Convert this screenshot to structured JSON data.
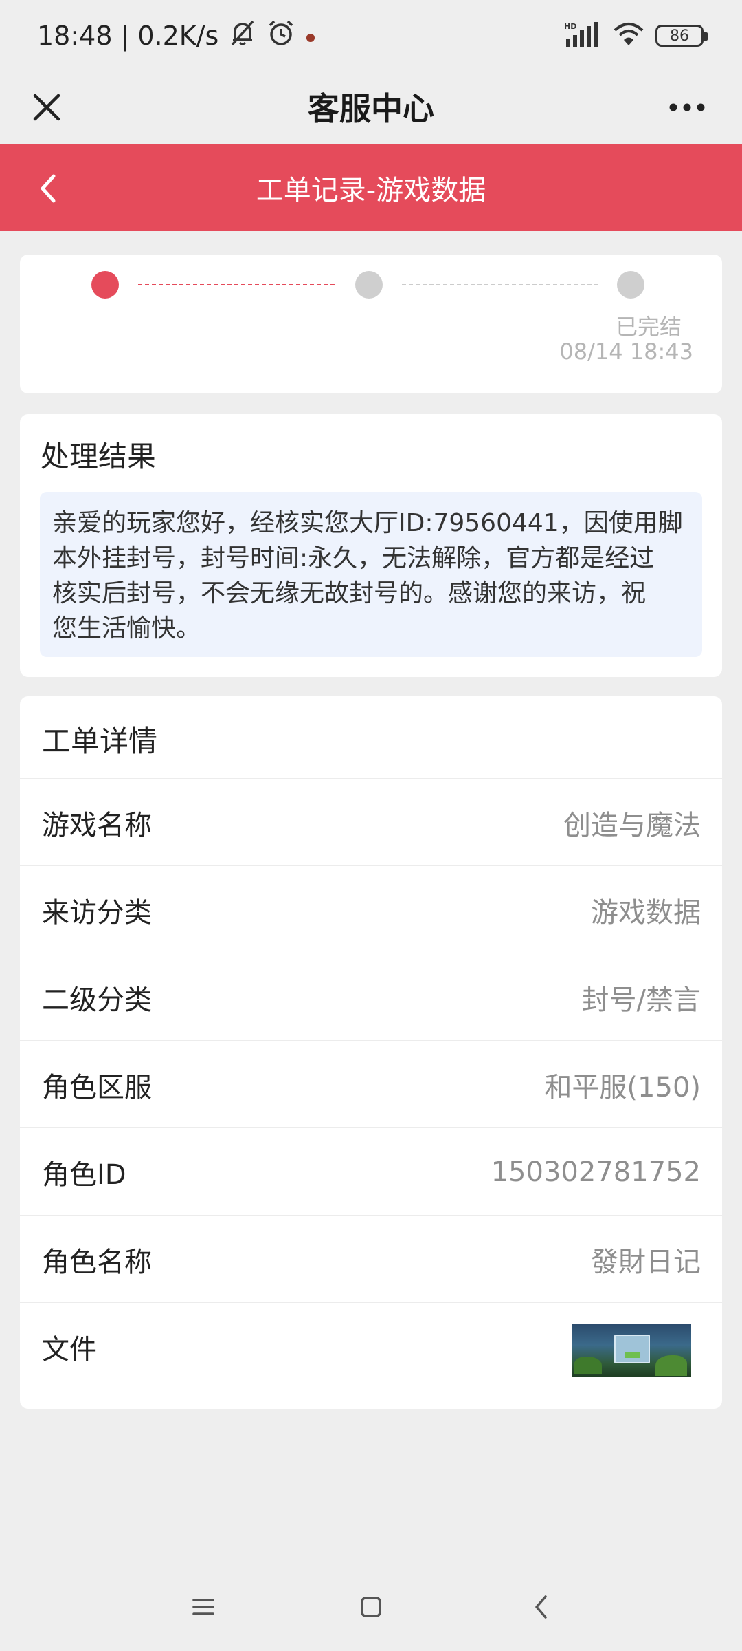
{
  "status_bar": {
    "time": "18:48",
    "separator": "|",
    "net_speed": "0.2K/s",
    "battery": "86",
    "signal_tag": "HD"
  },
  "header": {
    "title": "客服中心"
  },
  "subheader": {
    "title": "工单记录-游戏数据"
  },
  "progress": {
    "current_step": 1,
    "total_steps": 3,
    "final_status": "已完结",
    "final_time": "08/14 18:43"
  },
  "result": {
    "title": "处理结果",
    "lines": [
      "亲爱的玩家您好，经核实您大厅ID:79560441，因使用脚",
      "本外挂封号，封号时间:永久，无法解除，官方都是经过",
      "核实后封号，不会无缘无故封号的。感谢您的来访，祝",
      "您生活愉快。"
    ]
  },
  "details": {
    "title": "工单详情",
    "rows": [
      {
        "label": "游戏名称",
        "value": "创造与魔法"
      },
      {
        "label": "来访分类",
        "value": "游戏数据"
      },
      {
        "label": "二级分类",
        "value": "封号/禁言"
      },
      {
        "label": "角色区服",
        "value": "和平服(150)"
      },
      {
        "label": "角色ID",
        "value": "150302781752"
      },
      {
        "label": "角色名称",
        "value": "發財日记"
      }
    ],
    "file_label": "文件"
  },
  "colors": {
    "accent": "#e54b5b",
    "background": "#eeeeee",
    "result_box": "#eef3fd"
  }
}
